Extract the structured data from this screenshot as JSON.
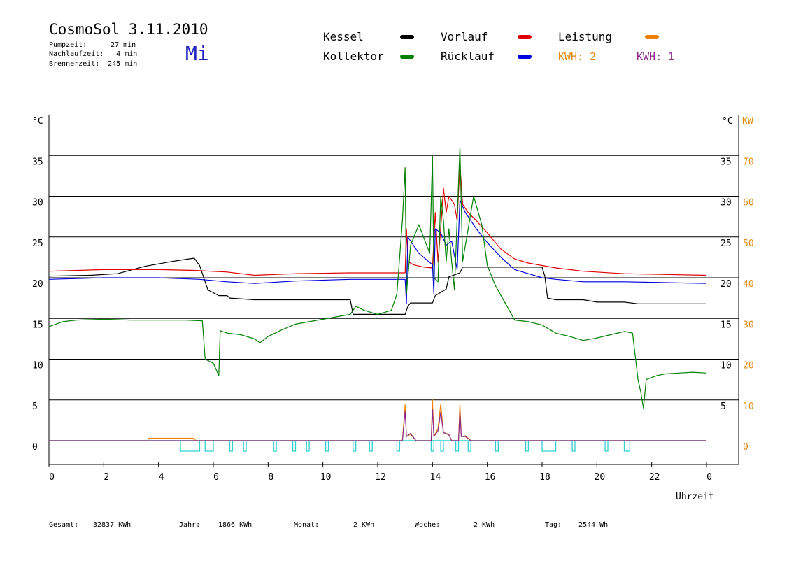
{
  "header": {
    "title": "CosmoSol 3.11.2010",
    "info": [
      {
        "label": "Pumpzeit:",
        "value": "27 min"
      },
      {
        "label": "Nachlaufzeit:",
        "value": "4 min"
      },
      {
        "label": "Brennerzeit:",
        "value": "245 min"
      }
    ],
    "weekday": "Mi"
  },
  "legend": [
    {
      "label": "Kessel",
      "color": "#000000"
    },
    {
      "label": "Kollektor",
      "color": "#008000"
    },
    {
      "label": "Vorlauf",
      "color": "#e00000"
    },
    {
      "label": "Rücklauf",
      "color": "#0000e0"
    },
    {
      "label": "Leistung",
      "color": "#f08000"
    }
  ],
  "kwh": [
    {
      "text": "KWH: 2",
      "color": "#e08a10"
    },
    {
      "text": "KWH: 1",
      "color": "#8a2a8a"
    }
  ],
  "footer": [
    {
      "label": "Gesamt:",
      "value": "32837 KWh"
    },
    {
      "label": "Jahr:",
      "value": "1866 KWh"
    },
    {
      "label": "Monat:",
      "value": "2 KWh"
    },
    {
      "label": "Woche:",
      "value": "2 KWh"
    },
    {
      "label": "Tag:",
      "value": "2544 Wh"
    }
  ],
  "chart_data": {
    "type": "line",
    "xlabel": "Uhrzeit",
    "y_left_label": "°C",
    "y_right_label": "°C",
    "y2_label": "KW",
    "x_ticks": [
      "0",
      "2",
      "4",
      "6",
      "8",
      "10",
      "12",
      "14",
      "16",
      "18",
      "20",
      "22",
      "0"
    ],
    "y_ticks": [
      0,
      5,
      10,
      15,
      20,
      25,
      30,
      35
    ],
    "y_right_ticks": [
      "5",
      "10",
      "15",
      "20",
      "25",
      "30",
      "35"
    ],
    "y2_ticks": [
      "0",
      "10",
      "20",
      "30",
      "40",
      "50",
      "60",
      "70"
    ],
    "xlim": [
      0,
      24
    ],
    "ylim": [
      -3,
      39
    ],
    "grid": "horizontal",
    "series": [
      {
        "name": "Kessel",
        "color": "#000000",
        "points": [
          [
            0,
            20.2
          ],
          [
            1.5,
            20.3
          ],
          [
            2.5,
            20.5
          ],
          [
            3.5,
            21.4
          ],
          [
            4.5,
            22
          ],
          [
            5.3,
            22.4
          ],
          [
            5.5,
            21.5
          ],
          [
            5.8,
            18.5
          ],
          [
            6.2,
            17.8
          ],
          [
            6.5,
            17.8
          ],
          [
            6.6,
            17.5
          ],
          [
            7.5,
            17.3
          ],
          [
            9,
            17.3
          ],
          [
            11,
            17.3
          ],
          [
            11.1,
            15.5
          ],
          [
            13,
            15.5
          ],
          [
            13.1,
            16.5
          ],
          [
            13.2,
            16.9
          ],
          [
            14,
            16.9
          ],
          [
            14.1,
            17.8
          ],
          [
            14.5,
            18.6
          ],
          [
            14.6,
            20.1
          ],
          [
            15,
            20.6
          ],
          [
            15.1,
            21.3
          ],
          [
            16,
            21.3
          ],
          [
            17.5,
            21.3
          ],
          [
            18,
            21.3
          ],
          [
            18.1,
            20.2
          ],
          [
            18.2,
            17.5
          ],
          [
            18.5,
            17.3
          ],
          [
            19.5,
            17.3
          ],
          [
            20,
            17
          ],
          [
            21,
            17
          ],
          [
            21.5,
            16.8
          ],
          [
            22.5,
            16.8
          ],
          [
            24,
            16.8
          ]
        ]
      },
      {
        "name": "Vorlauf",
        "color": "#e00000",
        "points": [
          [
            0,
            20.8
          ],
          [
            2,
            21
          ],
          [
            4,
            21
          ],
          [
            5.3,
            20.9
          ],
          [
            6.5,
            20.7
          ],
          [
            7.5,
            20.3
          ],
          [
            9,
            20.5
          ],
          [
            11,
            20.6
          ],
          [
            13,
            20.6
          ],
          [
            13.05,
            26
          ],
          [
            13.1,
            22
          ],
          [
            13.3,
            21.6
          ],
          [
            13.7,
            21.3
          ],
          [
            14,
            21.2
          ],
          [
            14.1,
            28
          ],
          [
            14.2,
            22
          ],
          [
            14.3,
            26
          ],
          [
            14.4,
            31
          ],
          [
            14.5,
            28
          ],
          [
            14.6,
            30
          ],
          [
            14.8,
            29
          ],
          [
            14.9,
            27
          ],
          [
            15,
            34
          ],
          [
            15.1,
            29
          ],
          [
            15.3,
            28
          ],
          [
            15.6,
            27
          ],
          [
            16,
            25.5
          ],
          [
            16.5,
            23.5
          ],
          [
            17,
            22.3
          ],
          [
            17.5,
            21.8
          ],
          [
            18,
            21.5
          ],
          [
            18.5,
            21.2
          ],
          [
            19.5,
            20.8
          ],
          [
            21,
            20.5
          ],
          [
            22.5,
            20.4
          ],
          [
            24,
            20.3
          ]
        ]
      },
      {
        "name": "Rücklauf",
        "color": "#0000e0",
        "points": [
          [
            0,
            19.8
          ],
          [
            2,
            20
          ],
          [
            4,
            20
          ],
          [
            5.5,
            19.8
          ],
          [
            6.5,
            19.5
          ],
          [
            7.5,
            19.3
          ],
          [
            9,
            19.6
          ],
          [
            11,
            19.8
          ],
          [
            13,
            19.8
          ],
          [
            13.05,
            16.8
          ],
          [
            13.1,
            25
          ],
          [
            13.5,
            23
          ],
          [
            14,
            21.6
          ],
          [
            14.05,
            18
          ],
          [
            14.1,
            26
          ],
          [
            14.3,
            25.5
          ],
          [
            14.5,
            24
          ],
          [
            14.7,
            24.5
          ],
          [
            14.9,
            21
          ],
          [
            15,
            29.5
          ],
          [
            15.2,
            28
          ],
          [
            15.6,
            26
          ],
          [
            16,
            24.3
          ],
          [
            16.5,
            22.5
          ],
          [
            17,
            21
          ],
          [
            17.5,
            20.5
          ],
          [
            18,
            20
          ],
          [
            18.5,
            19.8
          ],
          [
            19.5,
            19.5
          ],
          [
            21,
            19.5
          ],
          [
            22.5,
            19.4
          ],
          [
            24,
            19.3
          ]
        ]
      },
      {
        "name": "Kollektor",
        "color": "#008000",
        "points": [
          [
            0,
            14
          ],
          [
            0.5,
            14.6
          ],
          [
            1,
            14.8
          ],
          [
            2,
            14.9
          ],
          [
            3,
            14.8
          ],
          [
            4,
            14.8
          ],
          [
            5,
            14.8
          ],
          [
            5.6,
            14.7
          ],
          [
            5.7,
            10
          ],
          [
            6,
            9.5
          ],
          [
            6.2,
            8
          ],
          [
            6.25,
            13.5
          ],
          [
            6.5,
            13.2
          ],
          [
            7,
            13
          ],
          [
            7.5,
            12.5
          ],
          [
            7.7,
            12
          ],
          [
            8,
            12.8
          ],
          [
            8.5,
            13.6
          ],
          [
            9,
            14.3
          ],
          [
            10,
            14.9
          ],
          [
            11,
            15.5
          ],
          [
            11.2,
            16.5
          ],
          [
            11.5,
            16
          ],
          [
            12,
            15.5
          ],
          [
            12.5,
            16
          ],
          [
            12.7,
            18
          ],
          [
            12.9,
            27
          ],
          [
            13,
            33.5
          ],
          [
            13.05,
            18
          ],
          [
            13.2,
            24
          ],
          [
            13.5,
            26.5
          ],
          [
            13.9,
            23
          ],
          [
            14,
            35
          ],
          [
            14.05,
            20
          ],
          [
            14.2,
            19.5
          ],
          [
            14.3,
            30
          ],
          [
            14.4,
            27
          ],
          [
            14.5,
            22
          ],
          [
            14.6,
            26
          ],
          [
            14.7,
            22
          ],
          [
            14.8,
            18.5
          ],
          [
            15,
            36
          ],
          [
            15.1,
            22
          ],
          [
            15.3,
            26
          ],
          [
            15.5,
            30
          ],
          [
            15.8,
            26.5
          ],
          [
            16,
            21.5
          ],
          [
            16.3,
            19
          ],
          [
            16.8,
            16
          ],
          [
            17,
            14.8
          ],
          [
            17.5,
            14.6
          ],
          [
            18,
            14.2
          ],
          [
            18.5,
            13.2
          ],
          [
            19,
            12.8
          ],
          [
            19.5,
            12.3
          ],
          [
            20,
            12.6
          ],
          [
            20.5,
            13
          ],
          [
            21,
            13.4
          ],
          [
            21.3,
            13.2
          ],
          [
            21.5,
            7.5
          ],
          [
            21.6,
            6
          ],
          [
            21.7,
            4
          ],
          [
            21.8,
            7.5
          ],
          [
            22.2,
            8
          ],
          [
            22.5,
            8.2
          ],
          [
            23,
            8.3
          ],
          [
            23.5,
            8.4
          ],
          [
            24,
            8.3
          ]
        ]
      },
      {
        "name": "Leistung",
        "color": "#f08000",
        "points": [
          [
            0,
            0
          ],
          [
            3.6,
            0
          ],
          [
            3.65,
            0.3
          ],
          [
            5.3,
            0.3
          ],
          [
            5.35,
            0
          ],
          [
            12.9,
            0
          ],
          [
            13,
            4.4
          ],
          [
            13.05,
            0.5
          ],
          [
            13.2,
            0.8
          ],
          [
            13.4,
            0
          ],
          [
            13.95,
            0
          ],
          [
            14,
            5
          ],
          [
            14.05,
            0.5
          ],
          [
            14.2,
            1.5
          ],
          [
            14.3,
            4.5
          ],
          [
            14.4,
            1
          ],
          [
            14.6,
            0.8
          ],
          [
            14.7,
            0
          ],
          [
            14.95,
            0
          ],
          [
            15,
            4.5
          ],
          [
            15.05,
            0.5
          ],
          [
            15.2,
            0.6
          ],
          [
            15.4,
            0
          ],
          [
            24,
            0
          ]
        ]
      },
      {
        "name": "KWH: 1",
        "color": "#8a2a8a",
        "points": [
          [
            0,
            0
          ],
          [
            12.9,
            0
          ],
          [
            13,
            3.6
          ],
          [
            13.05,
            0.5
          ],
          [
            13.2,
            0.9
          ],
          [
            13.4,
            0
          ],
          [
            13.95,
            0
          ],
          [
            14,
            3.8
          ],
          [
            14.05,
            0.5
          ],
          [
            14.2,
            1.2
          ],
          [
            14.3,
            3.5
          ],
          [
            14.4,
            1
          ],
          [
            14.6,
            0.7
          ],
          [
            14.7,
            0
          ],
          [
            14.95,
            0
          ],
          [
            15,
            3.6
          ],
          [
            15.05,
            0.5
          ],
          [
            15.2,
            0.5
          ],
          [
            15.4,
            0
          ],
          [
            24,
            0
          ]
        ]
      }
    ],
    "pump_bar_color": "#30d0d0",
    "pump_intervals": [
      [
        4.8,
        5.5
      ],
      [
        5.7,
        6.0
      ],
      [
        6.6,
        6.7
      ],
      [
        7.1,
        7.2
      ],
      [
        8.2,
        8.3
      ],
      [
        8.9,
        9.0
      ],
      [
        9.4,
        9.5
      ],
      [
        10.1,
        10.2
      ],
      [
        11.1,
        11.2
      ],
      [
        11.7,
        11.8
      ],
      [
        12.7,
        12.8
      ],
      [
        13.95,
        14.05
      ],
      [
        14.3,
        14.4
      ],
      [
        14.85,
        14.95
      ],
      [
        15.3,
        15.4
      ],
      [
        16.3,
        16.4
      ],
      [
        17.4,
        17.5
      ],
      [
        18.0,
        18.5
      ],
      [
        19.1,
        19.2
      ],
      [
        20.3,
        20.4
      ],
      [
        21.0,
        21.2
      ]
    ]
  }
}
